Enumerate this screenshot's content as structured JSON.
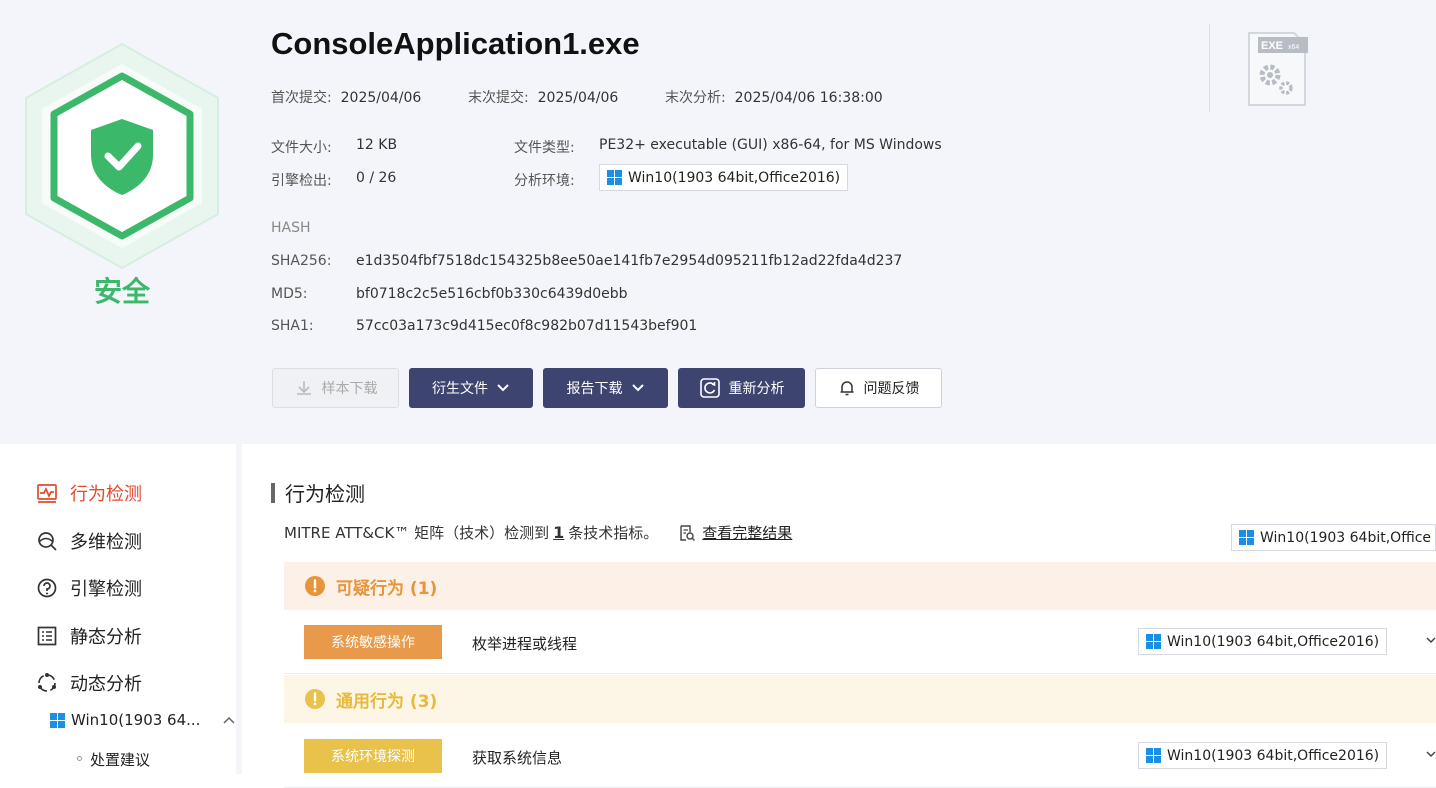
{
  "file": {
    "name": "ConsoleApplication1.exe",
    "verdict": "安全",
    "first_submit_label": "首次提交:",
    "first_submit": "2025/04/06",
    "last_submit_label": "末次提交:",
    "last_submit": "2025/04/06",
    "last_analysis_label": "末次分析:",
    "last_analysis": "2025/04/06 16:38:00",
    "size_label": "文件大小:",
    "size": "12 KB",
    "type_label": "文件类型:",
    "type": "PE32+ executable (GUI) x86-64, for MS Windows",
    "engine_label": "引擎检出:",
    "engine": "0 / 26",
    "env_label": "分析环境:",
    "env": "Win10(1903 64bit,Office2016)",
    "icon_text": "EXE",
    "icon_sub": "x64"
  },
  "hash": {
    "heading": "HASH",
    "sha256_label": "SHA256:",
    "sha256": "e1d3504fbf7518dc154325b8ee50ae141fb7e2954d095211fb12ad22fda4d237",
    "md5_label": "MD5:",
    "md5": "bf0718c2c5e516cbf0b330c6439d0ebb",
    "sha1_label": "SHA1:",
    "sha1": "57cc03a173c9d415ec0f8c982b07d11543bef901"
  },
  "actions": {
    "download_sample": "样本下载",
    "derived_files": "衍生文件",
    "report_download": "报告下载",
    "reanalyze": "重新分析",
    "feedback": "问题反馈"
  },
  "sidebar": {
    "items": [
      {
        "label": "行为检测",
        "icon": "activity-icon"
      },
      {
        "label": "多维检测",
        "icon": "multi-scan-icon"
      },
      {
        "label": "引擎检测",
        "icon": "engine-icon"
      },
      {
        "label": "静态分析",
        "icon": "list-icon"
      },
      {
        "label": "动态分析",
        "icon": "dynamic-icon"
      }
    ],
    "sub_env": "Win10(1903 64...",
    "sub_item": "处置建议"
  },
  "main": {
    "title": "行为检测",
    "mitre_prefix": "MITRE ATT&CK™ 矩阵（技术）检测到",
    "mitre_count": "1",
    "mitre_suffix": "条技术指标。",
    "view_full": "查看完整结果",
    "env_select": "Win10(1903 64bit,Office",
    "sections": [
      {
        "title": "可疑行为 (1)",
        "color": "#e8953a",
        "bg": "#fdf1e7"
      },
      {
        "title": "通用行为 (3)",
        "color": "#e8b93a",
        "bg": "#fdf6e7"
      }
    ],
    "rows": [
      {
        "tag": "系统敏感操作",
        "tag_color": "#e8994a",
        "text": "枚举进程或线程",
        "env": "Win10(1903 64bit,Office2016)"
      },
      {
        "tag": "系统环境探测",
        "tag_color": "#e8c24a",
        "text": "获取系统信息",
        "env": "Win10(1903 64bit,Office2016)"
      }
    ]
  },
  "colors": {
    "safe": "#3cb86a",
    "accent_dark": "#3d4470",
    "active_nav": "#e24a2e"
  }
}
